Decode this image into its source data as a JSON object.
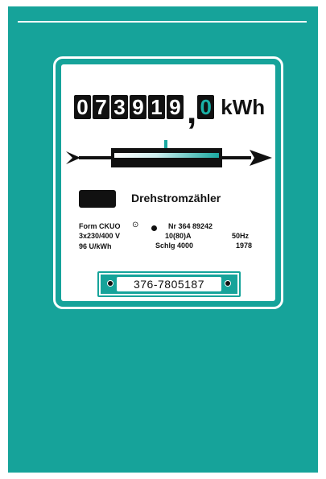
{
  "panel_color": "#16a39a",
  "counter": {
    "digits": [
      "0",
      "7",
      "3",
      "9",
      "1",
      "9"
    ],
    "separator": ",",
    "decimal": "0",
    "unit": "kWh"
  },
  "meter": {
    "title": "Drehstromzähler",
    "form": "Form CKUO",
    "voltage": "3x230/400 V",
    "constant": "96 U/kWh",
    "number": "Nr  364 89242",
    "current": "10(80)A",
    "schlg": "Schlg 4000",
    "frequency": "50Hz",
    "year": "1978",
    "serial": "376-7805187"
  }
}
